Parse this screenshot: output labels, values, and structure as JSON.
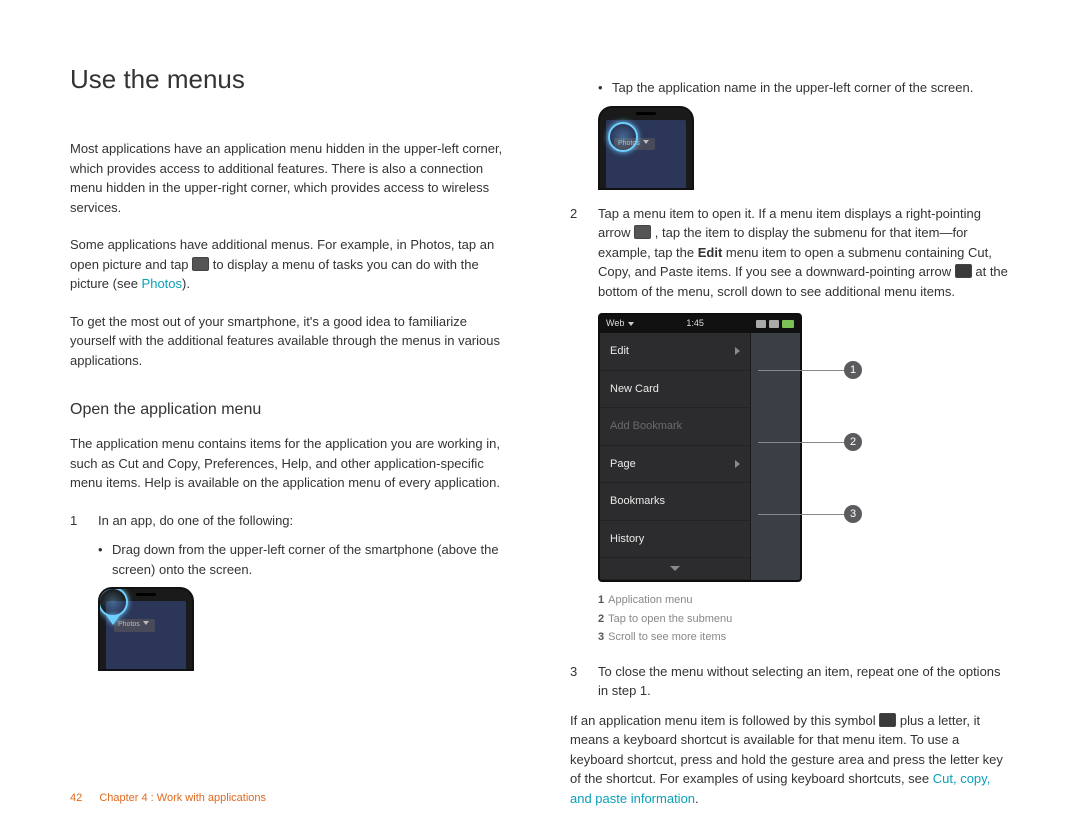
{
  "title": "Use the menus",
  "left": {
    "p1": "Most applications have an application menu hidden in the upper-left corner, which provides access to additional features. There is also a connection menu hidden in the upper-right corner, which provides access to wireless services.",
    "p2a": "Some applications have additional menus. For example, in Photos, tap an open picture and tap ",
    "p2b": " to display a menu of tasks you can do with the picture (see ",
    "p2_link": "Photos",
    "p2c": ").",
    "p3": "To get the most out of your smartphone, it's a good idea to familiarize yourself with the additional features available through the menus in various applications.",
    "h2": "Open the application menu",
    "p4": "The application menu contains items for the application you are working in, such as Cut and Copy, Preferences, Help, and other application-specific menu items. Help is available on the application menu of every application.",
    "step1_n": "1",
    "step1_t": "In an app, do one of the following:",
    "bul1": "Drag down from the upper-left corner of the smartphone (above the screen) onto the screen."
  },
  "right": {
    "bul2": "Tap the application name in the upper-left corner of the screen.",
    "step2_n": "2",
    "step2_a": "Tap a menu item to open it. If a menu item displays a right-pointing arrow ",
    "step2_b": ", tap the item to display the submenu for that item—for example, tap the ",
    "step2_edit": "Edit",
    "step2_c": " menu item to open a submenu containing Cut, Copy, and Paste items. If you see a downward-pointing arrow ",
    "step2_d": " at the bottom of the menu, scroll down to see additional menu items.",
    "menu": {
      "status_left": "Web",
      "status_time": "1:45",
      "items": [
        "Edit",
        "New Card",
        "Add Bookmark",
        "Page",
        "Bookmarks",
        "History"
      ]
    },
    "legend": {
      "l1n": "1",
      "l1t": "Application menu",
      "l2n": "2",
      "l2t": "Tap to open the submenu",
      "l3n": "3",
      "l3t": "Scroll to see more items"
    },
    "step3_n": "3",
    "step3_t": "To close the menu without selecting an item, repeat one of the options in step 1.",
    "p5a": "If an application menu item is followed by this symbol ",
    "p5b": " plus a letter, it means a keyboard shortcut is available for that menu item. To use a keyboard shortcut, press and hold the gesture area and press the letter key of the shortcut. For examples of using keyboard shortcuts, see ",
    "p5_link": "Cut, copy, and paste information",
    "p5c": "."
  },
  "footer": {
    "page": "42",
    "chapter": "Chapter 4 : Work with applications"
  }
}
